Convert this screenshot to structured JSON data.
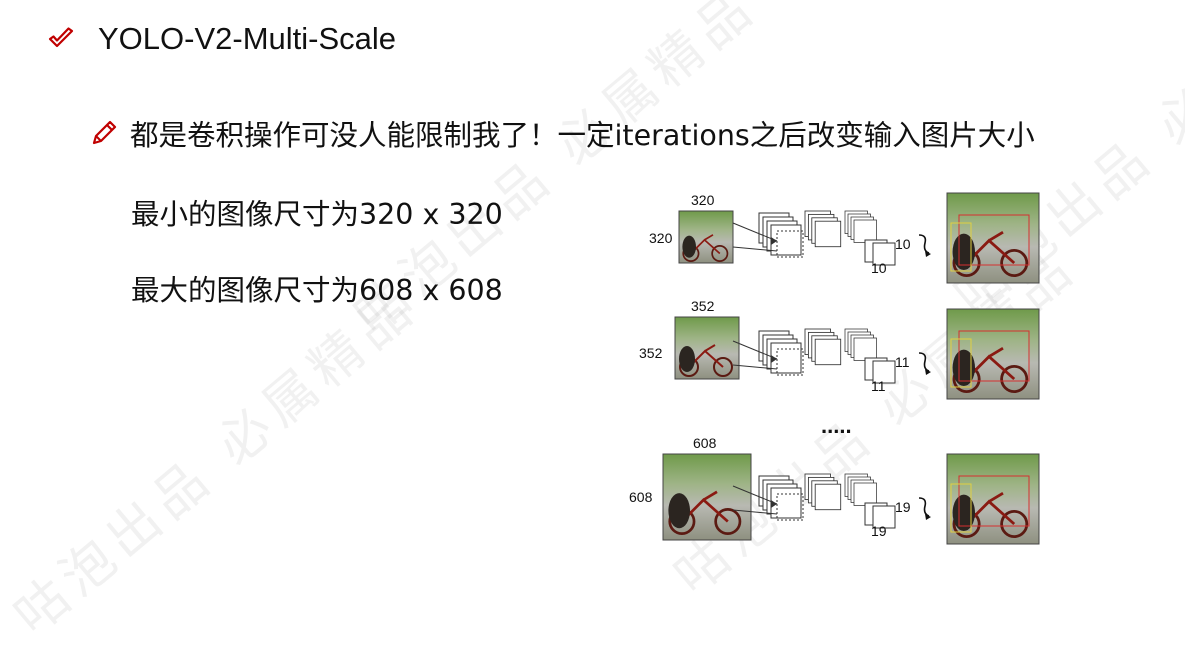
{
  "slide": {
    "title": "YOLO-V2-Multi-Scale",
    "bullet": "都是卷积操作可没人能限制我了！一定iterations之后改变输入图片大小",
    "min_size_text": "最小的图像尺寸为320 x 320",
    "max_size_text": "最大的图像尺寸为608 x 608"
  },
  "icons": {
    "title_marker": "check-icon",
    "bullet_marker": "pencil-icon"
  },
  "colors": {
    "accent": "#c00000"
  },
  "watermark": {
    "text": "咕泡出品 必属精品"
  },
  "diagram": {
    "rows": [
      {
        "input_size": "320",
        "grid_size": "10"
      },
      {
        "input_size": "352",
        "grid_size": "11"
      },
      {
        "input_size": "608",
        "grid_size": "19"
      }
    ],
    "ellipsis": "....."
  }
}
